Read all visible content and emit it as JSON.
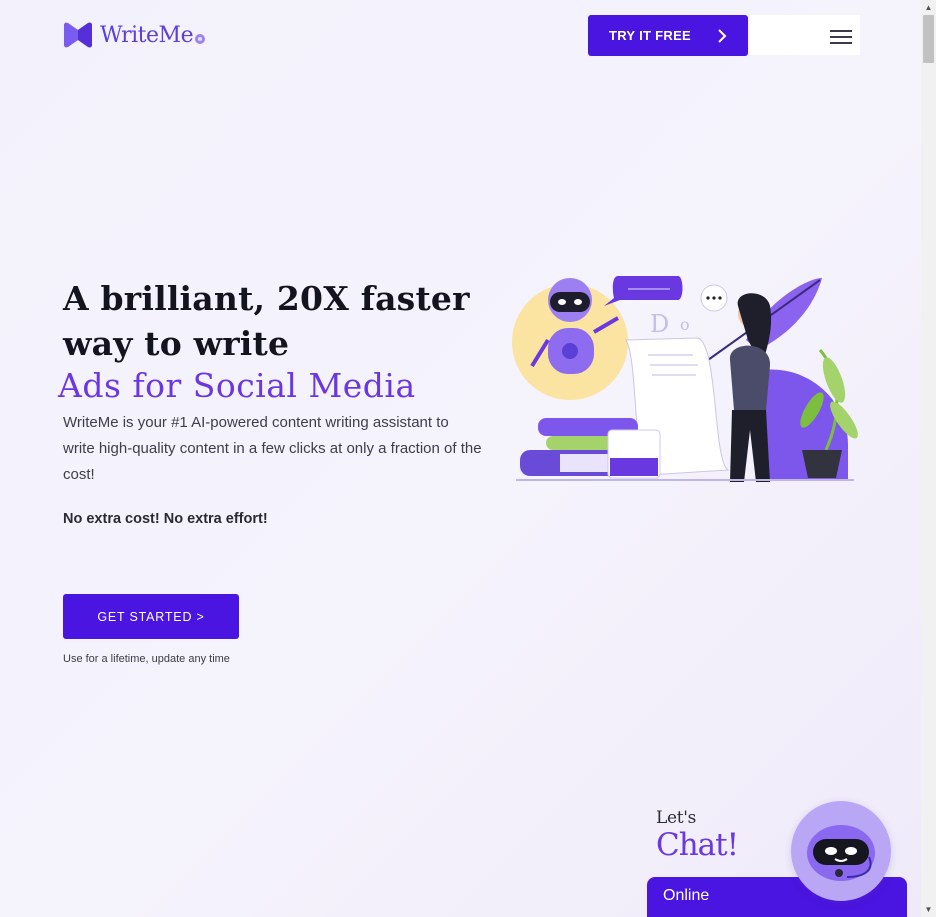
{
  "header": {
    "brand": "WriteMe",
    "try_button": "TRY IT FREE"
  },
  "hero": {
    "headline": "A brilliant, 20X faster way to write",
    "headline_accent": "Ads for Social Media",
    "lead": "WriteMe is your #1 AI-powered content writing assistant to write high-quality content in a few clicks at only a fraction of the cost!",
    "strong_line": "No extra cost! No extra effort!",
    "cta": "GET STARTED >",
    "cta_note": "Use for a lifetime, update any time"
  },
  "chat": {
    "lets": "Let's",
    "chat_word": "Chat!",
    "status": "Online"
  },
  "colors": {
    "brand": "#4a15e0",
    "accent": "#6a38e0",
    "background": "#f3f1fb"
  },
  "icons": [
    "brand-logo-icon",
    "chevron-right-icon",
    "hamburger-menu-icon",
    "robot-chat-icon"
  ]
}
